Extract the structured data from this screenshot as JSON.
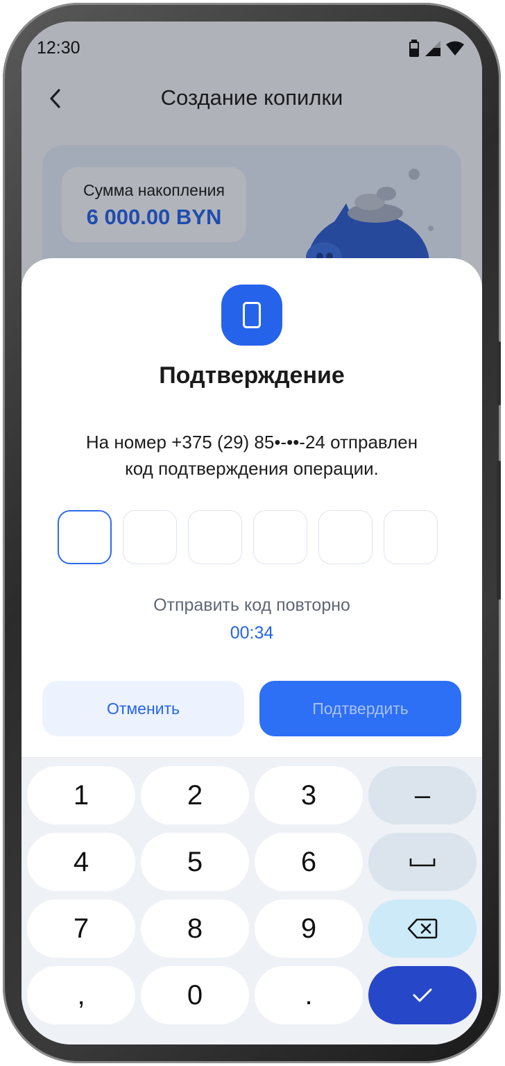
{
  "status_bar": {
    "time": "12:30"
  },
  "nav": {
    "title": "Создание копилки"
  },
  "savings": {
    "amount_label": "Сумма накопления",
    "amount_value": "6 000.00 BYN"
  },
  "sheet": {
    "icon": "phone-icon",
    "title": "Подтверждение",
    "message_line1": "На номер +375 (29) 85•-••-24 отправлен",
    "message_line2": "код подтверждения операции.",
    "code_cells": [
      "",
      "",
      "",
      "",
      "",
      ""
    ],
    "resend_label": "Отправить код повторно",
    "resend_timer": "00:34",
    "cancel_label": "Отменить",
    "confirm_label": "Подтвердить"
  },
  "keypad": {
    "keys": [
      "1",
      "2",
      "3",
      "4",
      "5",
      "6",
      "7",
      "8",
      "9",
      ",",
      "0",
      "."
    ],
    "minus": "–",
    "function_icons": [
      "space-icon",
      "backspace-icon",
      "check-icon"
    ]
  },
  "colors": {
    "accent": "#2563eb",
    "confirm_button": "#2d6ff5",
    "enter_key": "#2747c9",
    "backspace_key": "#cdeaf8"
  }
}
